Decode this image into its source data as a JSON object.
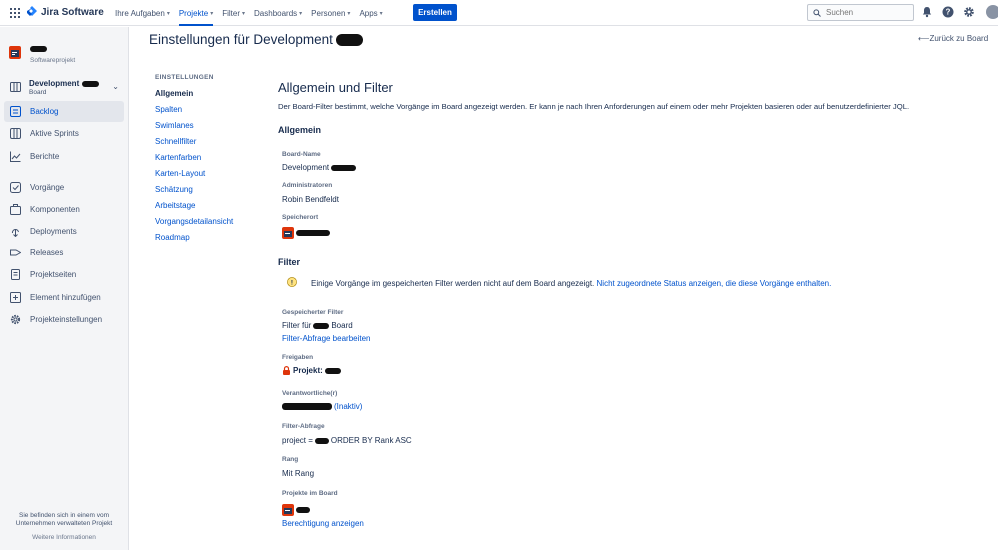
{
  "topbar": {
    "product": "Jira Software",
    "nav": [
      {
        "label": "Ihre Aufgaben",
        "active": false
      },
      {
        "label": "Projekte",
        "active": true
      },
      {
        "label": "Filter",
        "active": false
      },
      {
        "label": "Dashboards",
        "active": false
      },
      {
        "label": "Personen",
        "active": false
      },
      {
        "label": "Apps",
        "active": false
      }
    ],
    "create_label": "Erstellen",
    "search_placeholder": "Suchen",
    "accent": "#0052cc"
  },
  "sidebar": {
    "project_type": "Softwareprojekt",
    "board_name": "Development",
    "board_sub": "Board",
    "items": [
      {
        "label": "Backlog",
        "icon": "backlog-icon",
        "active": true
      },
      {
        "label": "Aktive Sprints",
        "icon": "sprints-icon",
        "active": false
      },
      {
        "label": "Berichte",
        "icon": "reports-icon",
        "active": false
      },
      {
        "label": "Vorgänge",
        "icon": "issues-icon",
        "active": false
      },
      {
        "label": "Komponenten",
        "icon": "components-icon",
        "active": false
      },
      {
        "label": "Deployments",
        "icon": "deployments-icon",
        "active": false
      },
      {
        "label": "Releases",
        "icon": "releases-icon",
        "active": false
      },
      {
        "label": "Projektseiten",
        "icon": "pages-icon",
        "active": false
      },
      {
        "label": "Element hinzufügen",
        "icon": "add-item-icon",
        "active": false
      },
      {
        "label": "Projekteinstellungen",
        "icon": "settings-icon",
        "active": false
      }
    ],
    "footer_text": "Sie befinden sich in einem vom Unternehmen verwalteten Projekt",
    "footer_link": "Weitere Informationen"
  },
  "header": {
    "title": "Einstellungen für Development",
    "back_label": "Zurück zu Board"
  },
  "settings_nav": {
    "heading": "EINSTELLUNGEN",
    "items": [
      {
        "label": "Allgemein",
        "active": true
      },
      {
        "label": "Spalten",
        "active": false
      },
      {
        "label": "Swimlanes",
        "active": false
      },
      {
        "label": "Schnellfilter",
        "active": false
      },
      {
        "label": "Kartenfarben",
        "active": false
      },
      {
        "label": "Karten-Layout",
        "active": false
      },
      {
        "label": "Schätzung",
        "active": false
      },
      {
        "label": "Arbeitstage",
        "active": false
      },
      {
        "label": "Vorgangsdetailansicht",
        "active": false
      },
      {
        "label": "Roadmap",
        "active": false
      }
    ]
  },
  "content": {
    "title": "Allgemein und Filter",
    "description": "Der Board-Filter bestimmt, welche Vorgänge im Board angezeigt werden. Er kann je nach Ihren Anforderungen auf einem oder mehr Projekten basieren oder auf benutzerdefinierter JQL.",
    "general": {
      "heading": "Allgemein",
      "board_name_label": "Board-Name",
      "board_name_value": "Development",
      "admins_label": "Administratoren",
      "admins_value": "Robin Bendfeldt",
      "location_label": "Speicherort"
    },
    "filter": {
      "heading": "Filter",
      "warning_text": "Einige Vorgänge im gespeicherten Filter werden nicht auf dem Board angezeigt.",
      "warning_link": "Nicht zugeordnete Status anzeigen, die diese Vorgänge enthalten.",
      "saved_label": "Gespeicherter Filter",
      "saved_prefix": "Filter für",
      "saved_suffix": "Board",
      "edit_query_link": "Filter-Abfrage bearbeiten",
      "shares_label": "Freigaben",
      "shares_value": "Projekt:",
      "owner_label": "Verantwortliche(r)",
      "owner_suffix": "(Inaktiv)",
      "query_label": "Filter-Abfrage",
      "query_prefix": "project =",
      "query_suffix": "ORDER BY Rank ASC",
      "rank_label": "Rang",
      "rank_value": "Mit Rang",
      "projects_label": "Projekte im Board",
      "permission_link": "Berechtigung anzeigen"
    }
  }
}
